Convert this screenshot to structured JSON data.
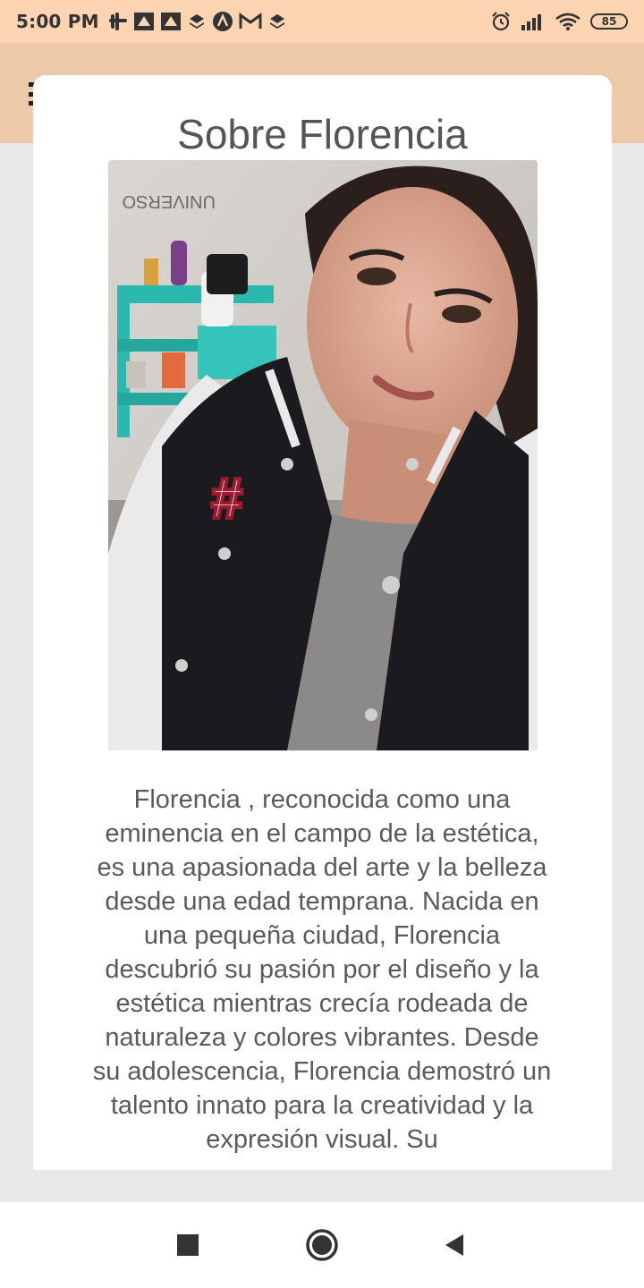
{
  "status_bar": {
    "time": "5:00 PM",
    "battery": "85",
    "notification_icons": [
      "slack-icon",
      "app-icon",
      "app-icon",
      "dropbox-icon",
      "app-a-icon",
      "gmail-icon",
      "dropbox-icon"
    ],
    "right_icons": [
      "alarm-icon",
      "signal-icon",
      "wifi-icon",
      "battery-icon"
    ]
  },
  "modal": {
    "title": "Sobre Florencia",
    "bio": "Florencia , reconocida como una eminencia en el campo de la estética, es una apasionada del arte y la belleza desde una edad temprana. Nacida en una pequeña ciudad, Florencia descubrió su pasión por el diseño y la estética mientras crecía rodeada de naturaleza y colores vibrantes. Desde su adolescencia, Florencia demostró un talento innato para la creatividad y la expresión visual. Su"
  },
  "nav_bar": {
    "buttons": [
      "recents-button",
      "home-button",
      "back-button"
    ]
  },
  "colors": {
    "status_bar": "#fcd4b2",
    "app_bar": "#eccaa9",
    "background": "#e8e8e8",
    "title_text": "#555555",
    "body_text": "#5a5a5a"
  }
}
